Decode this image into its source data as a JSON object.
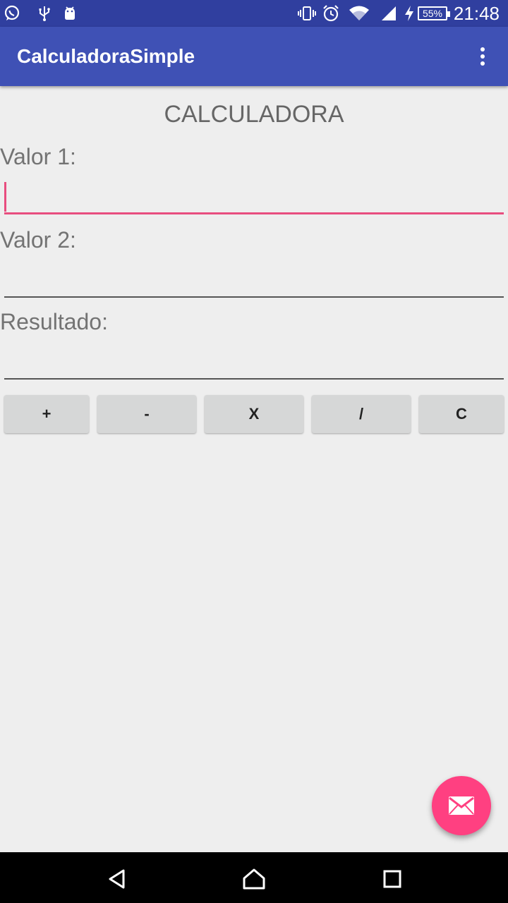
{
  "status_bar": {
    "time": "21:48",
    "battery": "55%",
    "left_icons": [
      "whatsapp-icon",
      "usb-icon",
      "android-debug-icon"
    ],
    "right_icons": [
      "vibrate-icon",
      "alarm-icon",
      "wifi-icon",
      "signal-icon",
      "charging-icon"
    ]
  },
  "app_bar": {
    "title": "CalculadoraSimple",
    "menu_icon": "more-vert-icon"
  },
  "main": {
    "heading": "CALCULADORA",
    "value1_label": "Valor 1:",
    "value1_value": "",
    "value2_label": "Valor 2:",
    "value2_value": "",
    "result_label": "Resultado:",
    "result_value": ""
  },
  "buttons": {
    "add": "+",
    "subtract": "-",
    "multiply": "X",
    "divide": "/",
    "clear": "C"
  },
  "fab": {
    "icon": "email-icon"
  },
  "nav_bar": {
    "icons": [
      "back-icon",
      "home-icon",
      "recents-icon"
    ]
  },
  "colors": {
    "status_bar": "#303F9F",
    "app_bar": "#3F51B5",
    "accent": "#FF4081",
    "focus_line": "#E84D7F",
    "background": "#EEEEEE",
    "button": "#D6D7D7"
  }
}
